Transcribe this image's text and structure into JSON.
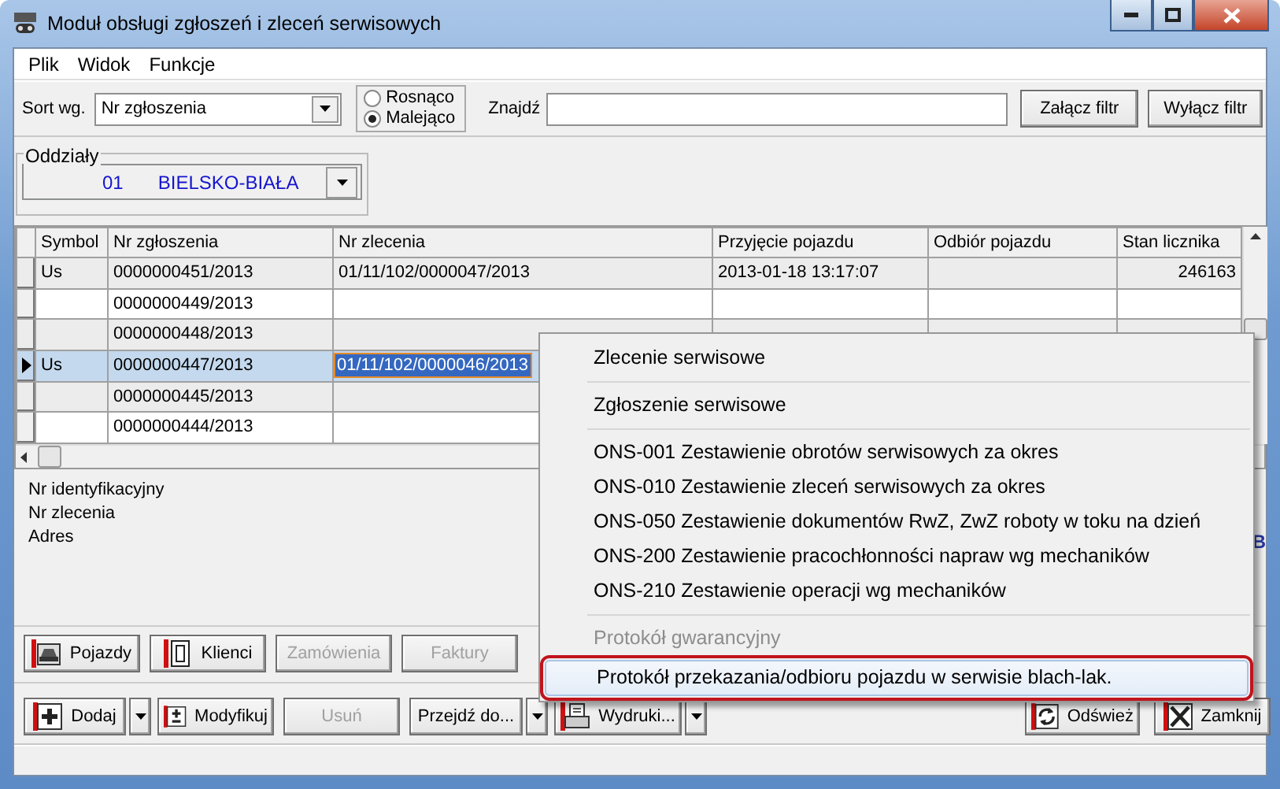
{
  "window": {
    "title": "Moduł obsługi zgłoszeń i zleceń serwisowych"
  },
  "menu": [
    "Plik",
    "Widok",
    "Funkcje"
  ],
  "toolbar": {
    "sort_label": "Sort wg.",
    "sort_value": "Nr zgłoszenia",
    "order": [
      {
        "label": "Rosnąco",
        "selected": false
      },
      {
        "label": "Malejąco",
        "selected": true
      }
    ],
    "find_label": "Znajdź",
    "buttons": [
      "Załącz filtr",
      "Wyłącz filtr"
    ]
  },
  "branch": {
    "title": "Oddziały",
    "code": "01",
    "name": "BIELSKO-BIAŁA"
  },
  "grid": {
    "columns": [
      "Symbol",
      "Nr zgłoszenia",
      "Nr zlecenia",
      "Przyjęcie pojazdu",
      "Odbiór pojazdu",
      "Stan licznika"
    ],
    "rows": [
      {
        "symbol": "Us",
        "request_no": "0000000451/2013",
        "order_no": "01/11/102/0000047/2013",
        "received": "2013-01-18 13:17:07",
        "odometer": "246163",
        "selected": false
      },
      {
        "request_no": "0000000449/2013",
        "selected": false
      },
      {
        "request_no": "0000000448/2013",
        "selected": false
      },
      {
        "symbol": "Us",
        "request_no": "0000000447/2013",
        "order_no": "01/11/102/0000046/2013",
        "selected": true
      },
      {
        "request_no": "0000000445/2013",
        "selected": false
      },
      {
        "request_no": "0000000444/2013",
        "selected": false
      }
    ]
  },
  "details": {
    "labels": [
      "Nr identyfikacyjny",
      "Nr zlecenia",
      "Adres"
    ],
    "cut_text": "B"
  },
  "nav_buttons": [
    {
      "label": "Pojazdy",
      "kind": "car",
      "disabled": false
    },
    {
      "label": "Klienci",
      "kind": "person",
      "disabled": false
    },
    {
      "label": "Zamówienia",
      "kind": "none",
      "disabled": true
    },
    {
      "label": "Faktury",
      "kind": "none",
      "disabled": true
    }
  ],
  "action_buttons": [
    {
      "label": "Dodaj",
      "kind": "add",
      "disabled": false,
      "split": true
    },
    {
      "label": "Modyfikuj",
      "kind": "edit",
      "disabled": false,
      "split": false
    },
    {
      "label": "Usuń",
      "kind": "none",
      "disabled": true,
      "split": false
    },
    {
      "label": "Przejdź do...",
      "kind": "none",
      "disabled": false,
      "split": true
    },
    {
      "label": "Wydruki...",
      "kind": "print",
      "disabled": false,
      "split": true
    }
  ],
  "right_buttons": [
    {
      "label": "Odśwież",
      "kind": "refresh",
      "disabled": false
    },
    {
      "label": "Zamknij",
      "kind": "close",
      "disabled": false
    }
  ],
  "context_menu": {
    "groups": [
      [
        {
          "label": "Zlecenie serwisowe",
          "disabled": false,
          "selected": false
        }
      ],
      [
        {
          "label": "Zgłoszenie serwisowe",
          "disabled": false,
          "selected": false
        }
      ],
      [
        {
          "label": "ONS-001 Zestawienie obrotów serwisowych za okres",
          "disabled": false,
          "selected": false
        },
        {
          "label": "ONS-010 Zestawienie zleceń serwisowych za okres",
          "disabled": false,
          "selected": false
        },
        {
          "label": "ONS-050 Zestawienie dokumentów RwZ, ZwZ roboty w toku na dzień",
          "disabled": false,
          "selected": false
        },
        {
          "label": "ONS-200 Zestawienie pracochłonności napraw wg mechaników",
          "disabled": false,
          "selected": false
        },
        {
          "label": "ONS-210 Zestawienie operacji wg mechaników",
          "disabled": false,
          "selected": false
        }
      ],
      [
        {
          "label": "Protokół gwarancyjny",
          "disabled": true,
          "selected": false
        },
        {
          "label": "Protokół przekazania/odbioru pojazdu w serwisie blach-lak.",
          "disabled": false,
          "selected": true
        }
      ]
    ]
  }
}
